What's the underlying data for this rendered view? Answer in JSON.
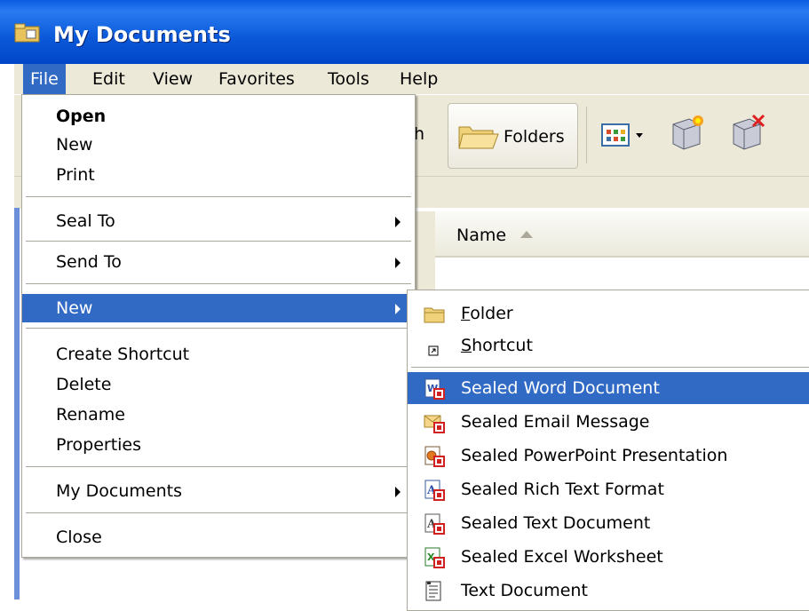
{
  "window": {
    "title": "My Documents"
  },
  "menubar": {
    "items": [
      {
        "label": "File",
        "active": true
      },
      {
        "label": "Edit"
      },
      {
        "label": "View"
      },
      {
        "label": "Favorites"
      },
      {
        "label": "Tools"
      },
      {
        "label": "Help"
      }
    ]
  },
  "toolbar": {
    "partial_label": "h",
    "folders_label": "Folders"
  },
  "list": {
    "name_header": "Name"
  },
  "file_menu": {
    "open": "Open",
    "new_doc": "New",
    "print": "Print",
    "seal_to": "Seal To",
    "send_to": "Send To",
    "new": "New",
    "create_shortcut": "Create Shortcut",
    "delete": "Delete",
    "rename": "Rename",
    "properties": "Properties",
    "my_documents": "My Documents",
    "close": "Close"
  },
  "new_submenu": {
    "folder_access": "F",
    "folder_rest": "older",
    "shortcut_access": "S",
    "shortcut_rest": "hortcut",
    "sealed_word": "Sealed Word Document",
    "sealed_email": "Sealed Email Message",
    "sealed_ppt": "Sealed PowerPoint Presentation",
    "sealed_rtf": "Sealed Rich Text Format",
    "sealed_txt": "Sealed Text Document",
    "sealed_excel": "Sealed Excel Worksheet",
    "text_document": "Text Document"
  },
  "colors": {
    "highlight": "#316ac5",
    "titlebar": "#0a58d8",
    "chrome": "#ece9d8"
  }
}
